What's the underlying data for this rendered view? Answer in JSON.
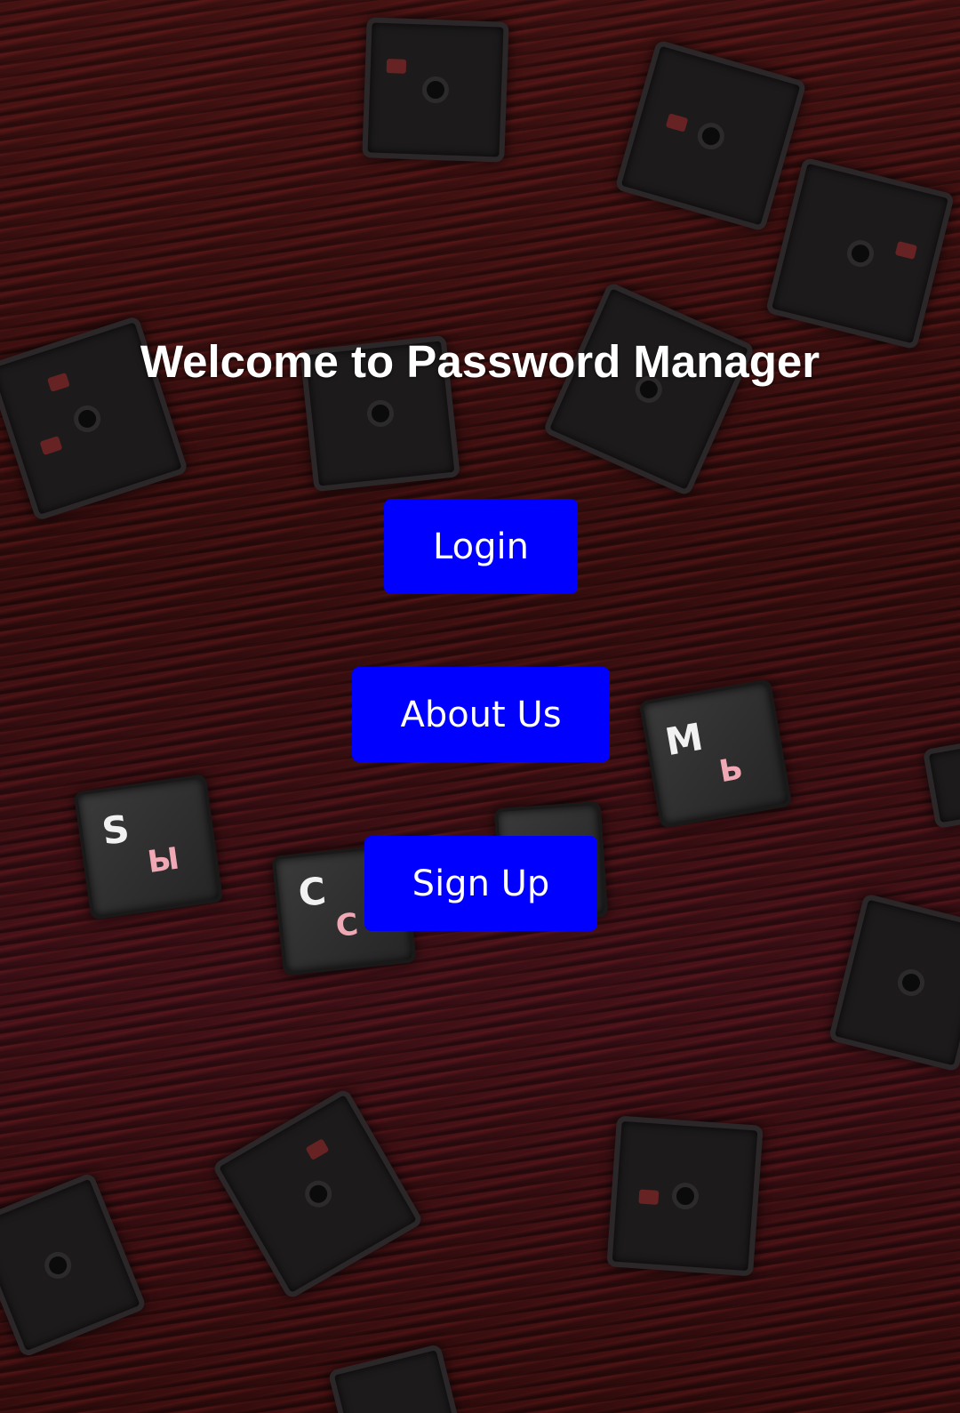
{
  "page": {
    "title": "Welcome to Password Manager"
  },
  "buttons": {
    "login": "Login",
    "about": "About Us",
    "signup": "Sign Up"
  },
  "background": {
    "key_letters": [
      {
        "main": "S",
        "sub": "Ы"
      },
      {
        "main": "C",
        "sub": "C"
      },
      {
        "main": "M",
        "sub": "Ь"
      }
    ]
  },
  "colors": {
    "button": "#0000ff",
    "button_text": "#ffffff",
    "title_text": "#ffffff",
    "background": "#3a0f0f"
  }
}
